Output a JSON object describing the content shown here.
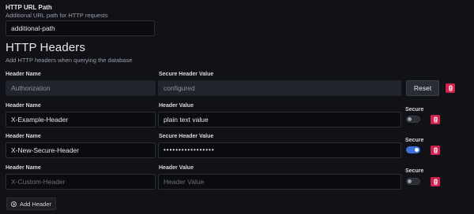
{
  "url_path": {
    "label": "HTTP URL Path",
    "description": "Additional URL path for HTTP requests",
    "value": "additional-path"
  },
  "headers_section": {
    "title": "HTTP Headers",
    "description": "Add HTTP headers when querying the database"
  },
  "headers": [
    {
      "name_label": "Header Name",
      "name_value": "Authorization",
      "value_label": "Secure Header Value",
      "value_value": "configured",
      "configured": true,
      "reset_label": "Reset"
    },
    {
      "name_label": "Header Name",
      "name_value": "X-Example-Header",
      "value_label": "Header Value",
      "value_value": "plain text value",
      "secure_label": "Secure",
      "secure": false
    },
    {
      "name_label": "Header Name",
      "name_value": "X-New-Secure-Header",
      "value_label": "Secure Header Value",
      "value_value": "•••••••••••••••••",
      "secure_label": "Secure",
      "secure": true
    },
    {
      "name_label": "Header Name",
      "name_placeholder": "X-Custom-Header",
      "value_label": "Header Value",
      "value_placeholder": "Header Value",
      "secure_label": "Secure",
      "secure": false
    }
  ],
  "add_header_label": "Add Header",
  "colors": {
    "background": "#111217",
    "delete": "#d0224f",
    "toggle_on": "#3d71d9"
  },
  "icons": {
    "delete": "trash-icon",
    "add": "plus-circle-icon"
  }
}
